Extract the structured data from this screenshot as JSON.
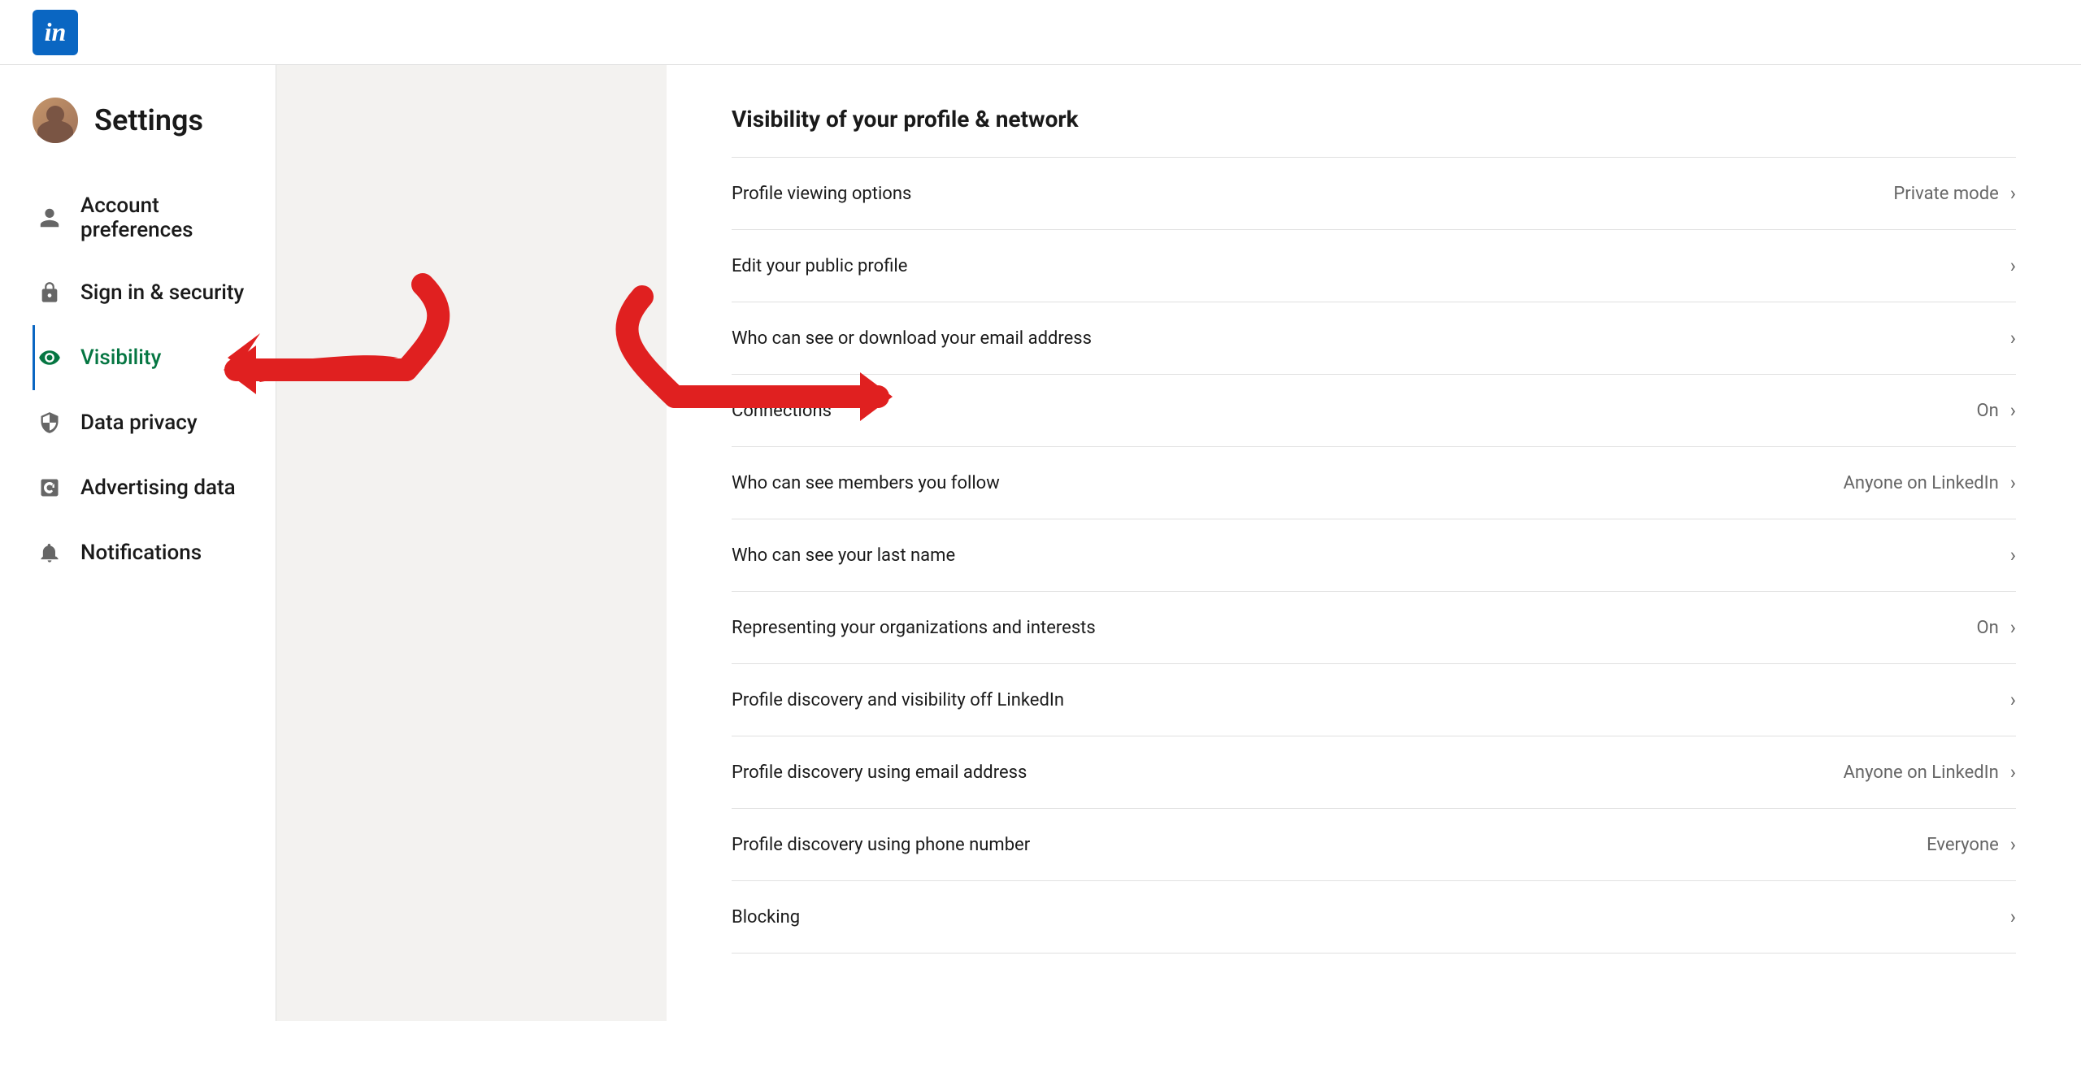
{
  "header": {
    "logo_text": "in"
  },
  "sidebar": {
    "settings_label": "Settings",
    "nav_items": [
      {
        "id": "account-preferences",
        "label": "Account preferences",
        "icon": "person",
        "active": false
      },
      {
        "id": "sign-in-security",
        "label": "Sign in & security",
        "icon": "lock",
        "active": false
      },
      {
        "id": "visibility",
        "label": "Visibility",
        "icon": "eye",
        "active": true
      },
      {
        "id": "data-privacy",
        "label": "Data privacy",
        "icon": "shield",
        "active": false
      },
      {
        "id": "advertising-data",
        "label": "Advertising data",
        "icon": "ad",
        "active": false
      },
      {
        "id": "notifications",
        "label": "Notifications",
        "icon": "bell",
        "active": false
      }
    ]
  },
  "main": {
    "section_title": "Visibility of your profile & network",
    "items": [
      {
        "id": "profile-viewing-options",
        "label": "Profile viewing options",
        "value": "Private mode",
        "has_value": true
      },
      {
        "id": "edit-public-profile",
        "label": "Edit your public profile",
        "value": "",
        "has_value": false
      },
      {
        "id": "email-visibility",
        "label": "Who can see or download your email address",
        "value": "",
        "has_value": false
      },
      {
        "id": "connections",
        "label": "Connections",
        "value": "On",
        "has_value": true
      },
      {
        "id": "members-you-follow",
        "label": "Who can see members you follow",
        "value": "Anyone on LinkedIn",
        "has_value": true
      },
      {
        "id": "last-name",
        "label": "Who can see your last name",
        "value": "",
        "has_value": false
      },
      {
        "id": "organizations",
        "label": "Representing your organizations and interests",
        "value": "On",
        "has_value": true
      },
      {
        "id": "profile-discovery-off",
        "label": "Profile discovery and visibility off LinkedIn",
        "value": "",
        "has_value": false
      },
      {
        "id": "profile-discovery-email",
        "label": "Profile discovery using email address",
        "value": "Anyone on LinkedIn",
        "has_value": true
      },
      {
        "id": "profile-discovery-phone",
        "label": "Profile discovery using phone number",
        "value": "Everyone",
        "has_value": true
      },
      {
        "id": "blocking",
        "label": "Blocking",
        "value": "",
        "has_value": false
      }
    ]
  },
  "colors": {
    "linkedin_blue": "#0a66c2",
    "active_green": "#057642",
    "border": "#e0e0e0",
    "text_primary": "#1a1a1a",
    "text_secondary": "#666",
    "bg_gray": "#f3f2f0",
    "red_arrow": "#e02020"
  }
}
